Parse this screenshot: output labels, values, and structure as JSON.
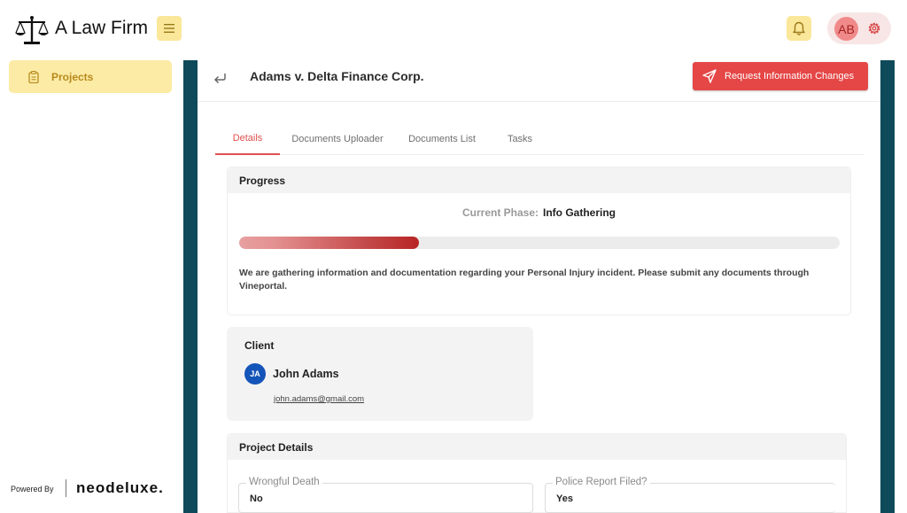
{
  "header": {
    "brand": "A Law Firm",
    "avatar_initials": "AB"
  },
  "sidebar": {
    "items": [
      {
        "label": "Projects",
        "icon": "clipboard-icon"
      }
    ],
    "powered_by": "Powered By",
    "powered_brand": "neodeluxe."
  },
  "main": {
    "title": "Adams v. Delta Finance Corp.",
    "request_button": "Request Information Changes",
    "tabs": [
      "Details",
      "Documents Uploader",
      "Documents List",
      "Tasks"
    ],
    "active_tab": "Details"
  },
  "progress": {
    "title": "Progress",
    "phase_label": "Current Phase:",
    "phase_value": "Info Gathering",
    "fill_fraction": 0.3,
    "description": "We are gathering information and documentation regarding your Personal Injury incident. Please submit any documents through Vineportal."
  },
  "client": {
    "title": "Client",
    "initials": "JA",
    "name": "John Adams",
    "email": "john.adams@gmail.com"
  },
  "project_details": {
    "title": "Project Details",
    "fields": [
      {
        "label": "Wrongful Death",
        "value": "No"
      },
      {
        "label": "Police Report Filed?",
        "value": "Yes"
      }
    ]
  },
  "colors": {
    "accent_red": "#e54646",
    "frame_teal": "#0e4a59",
    "highlight_yellow": "#fbeba5"
  }
}
